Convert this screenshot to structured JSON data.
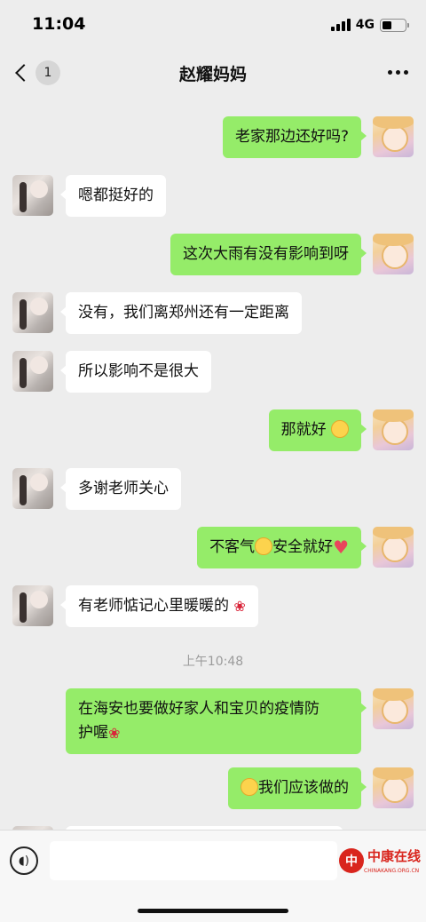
{
  "status_bar": {
    "time": "11:04",
    "network": "4G"
  },
  "nav": {
    "unread_count": "1",
    "title": "赵耀妈妈"
  },
  "messages": [
    {
      "from": "me",
      "text": "老家那边还好吗?"
    },
    {
      "from": "them",
      "text": "嗯都挺好的"
    },
    {
      "from": "me",
      "text": "这次大雨有没有影响到呀"
    },
    {
      "from": "them",
      "text": "没有，我们离郑州还有一定距离"
    },
    {
      "from": "them",
      "text": "所以影响不是很大"
    },
    {
      "from": "me",
      "text": "那就好",
      "emoji_after": "smile-emoji"
    },
    {
      "from": "them",
      "text": "多谢老师关心"
    },
    {
      "from": "me",
      "text_a": "不客气",
      "emoji_mid": "smile-emoji",
      "text_b": "安全就好",
      "emoji_after": "heart-emoji"
    },
    {
      "from": "them",
      "text": "有老师惦记心里暖暖的",
      "emoji_after": "rose-emoji"
    },
    {
      "from": "me",
      "text_line1": "在海安也要做好家人和宝贝的疫情防",
      "text_line2": "护喔",
      "emoji_after": "rose-emoji"
    },
    {
      "from": "me",
      "emoji_before": "grin-emoji",
      "text": "我们应该做的"
    }
  ],
  "timestamp": "上午10:48",
  "watermark": {
    "logo_char": "中",
    "text": "中康在线",
    "sub": "CHINAKANG.ORG.CN"
  },
  "colors": {
    "me_bubble": "#95ec69",
    "them_bubble": "#ffffff",
    "background": "#ededed",
    "watermark": "#d9251d"
  }
}
